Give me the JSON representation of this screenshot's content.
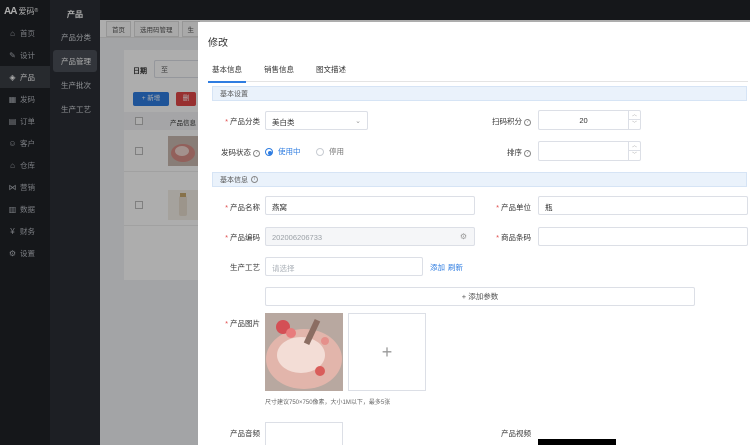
{
  "app": {
    "brand": "爱码",
    "brand_sup": "®"
  },
  "sidebar": {
    "items": [
      {
        "label": "首页",
        "icon": "home-icon",
        "glyph": "⌂"
      },
      {
        "label": "设计",
        "icon": "design-icon",
        "glyph": "✎"
      },
      {
        "label": "产品",
        "icon": "product-icon",
        "glyph": "◈",
        "active": true
      },
      {
        "label": "发码",
        "icon": "code-icon",
        "glyph": "▦"
      },
      {
        "label": "订单",
        "icon": "order-icon",
        "glyph": "▤"
      },
      {
        "label": "客户",
        "icon": "customer-icon",
        "glyph": "☺"
      },
      {
        "label": "仓库",
        "icon": "warehouse-icon",
        "glyph": "⌂"
      },
      {
        "label": "营销",
        "icon": "marketing-icon",
        "glyph": "⋈"
      },
      {
        "label": "数据",
        "icon": "data-icon",
        "glyph": "▥"
      },
      {
        "label": "财务",
        "icon": "finance-icon",
        "glyph": "¥"
      },
      {
        "label": "设置",
        "icon": "settings-icon",
        "glyph": "⚙"
      }
    ]
  },
  "subsidebar": {
    "title": "产品",
    "items": [
      {
        "label": "产品分类"
      },
      {
        "label": "产品管理",
        "active": true
      },
      {
        "label": "生产批次"
      },
      {
        "label": "生产工艺"
      }
    ]
  },
  "background": {
    "tabs": [
      "首页",
      "选用码管理",
      "生"
    ],
    "date_label": "日期",
    "date_value": "至",
    "new_button": "+ 新增",
    "red_button": "删",
    "table_header": "产品信息"
  },
  "modal": {
    "title": "修改",
    "tabs": [
      {
        "label": "基本信息",
        "active": true
      },
      {
        "label": "销售信息"
      },
      {
        "label": "图文描述"
      }
    ],
    "section1": {
      "title": "基本设置"
    },
    "category": {
      "label": "产品分类",
      "value": "美白类"
    },
    "scan_points": {
      "label": "扫码积分",
      "value": "20"
    },
    "code_status": {
      "label": "发码状态",
      "options": [
        "使用中",
        "停用"
      ],
      "selected": "使用中"
    },
    "sort": {
      "label": "排序",
      "value": ""
    },
    "section2": {
      "title": "基本信息"
    },
    "name": {
      "label": "产品名称",
      "value": "燕窝"
    },
    "unit": {
      "label": "产品单位",
      "value": "瓶"
    },
    "code": {
      "label": "产品编码",
      "value": "202006206733"
    },
    "barcode": {
      "label": "商品条码",
      "value": ""
    },
    "process": {
      "label": "生产工艺",
      "placeholder": "请选择",
      "add_link": "添加",
      "refresh_link": "刷新"
    },
    "add_param": {
      "label": "+ 添加参数"
    },
    "image": {
      "label": "产品图片",
      "hint": "尺寸建议750×750像素，大小1M以下，最多5张",
      "upload_glyph": "+"
    },
    "audio": {
      "label": "产品音频"
    },
    "video": {
      "label": "产品视频"
    }
  },
  "colors": {
    "accent": "#2f7de1",
    "danger": "#e04848",
    "sidebar_bg": "#1f2227"
  }
}
